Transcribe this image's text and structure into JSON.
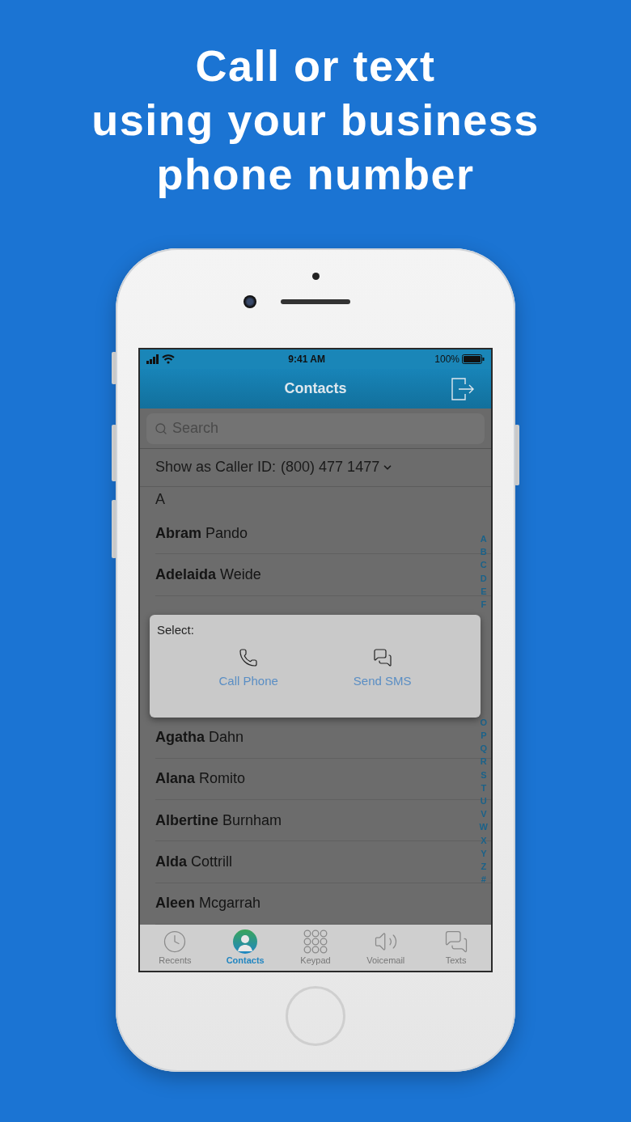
{
  "headline": [
    "Call or text",
    "using your business",
    "phone number"
  ],
  "status_bar": {
    "time": "9:41 AM",
    "battery": "100%"
  },
  "nav": {
    "title": "Contacts"
  },
  "search": {
    "placeholder": "Search"
  },
  "caller_id": {
    "label": "Show as Caller ID:",
    "number": "(800) 477 1477"
  },
  "section": "A",
  "rows_above": [
    "**Abram** Pando",
    "**Adelaida** Weide"
  ],
  "rows_below": [
    "**Agatha** Dahn",
    "**Alana** Romito",
    "**Albertine** Burnham",
    "**Alda** Cottrill",
    "**Aleen** Mcgarrah"
  ],
  "index_top": [
    "A",
    "B",
    "C",
    "D",
    "E",
    "F"
  ],
  "index_bottom": [
    "O",
    "P",
    "Q",
    "R",
    "S",
    "T",
    "U",
    "V",
    "W",
    "X",
    "Y",
    "Z",
    "#"
  ],
  "dialog": {
    "title": "Select:",
    "actions": [
      "Call Phone",
      "Send SMS"
    ]
  },
  "tabs": [
    {
      "label": "Recents",
      "selected": false
    },
    {
      "label": "Contacts",
      "selected": true
    },
    {
      "label": "Keypad",
      "selected": false
    },
    {
      "label": "Voicemail",
      "selected": false
    },
    {
      "label": "Texts",
      "selected": false
    }
  ]
}
